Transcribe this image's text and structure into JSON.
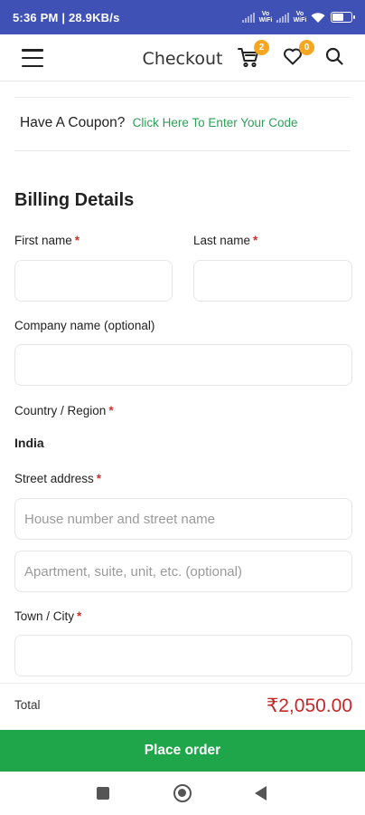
{
  "status_bar": {
    "time": "5:36 PM | 28.9KB/s",
    "volte_1": "Vo WiFi",
    "volte_2": "Vo WiFi",
    "battery_level": 0.55
  },
  "header": {
    "title": "Checkout",
    "cart_count": "2",
    "wishlist_count": "0",
    "icons": [
      "menu-icon",
      "cart-icon",
      "heart-icon",
      "search-icon"
    ]
  },
  "coupon": {
    "prompt": "Have A Coupon?",
    "link": "Click Here To Enter Your Code"
  },
  "billing": {
    "title": "Billing Details",
    "first_name_label": "First name",
    "last_name_label": "Last name",
    "company_label": "Company name (optional)",
    "country_label": "Country / Region",
    "country_value": "India",
    "street_label": "Street address",
    "street_placeholder": "House number and street name",
    "apartment_placeholder": "Apartment, suite, unit, etc. (optional)",
    "city_label": "Town / City",
    "required_mark": "*"
  },
  "footer": {
    "total_label": "Total",
    "total_value": "₹2,050.00",
    "place_order": "Place order"
  },
  "colors": {
    "status_bar": "#3f51b5",
    "accent_green": "#1fa64a",
    "link_green": "#2e9e58",
    "price_red": "#c62828",
    "badge": "#f5a623"
  }
}
